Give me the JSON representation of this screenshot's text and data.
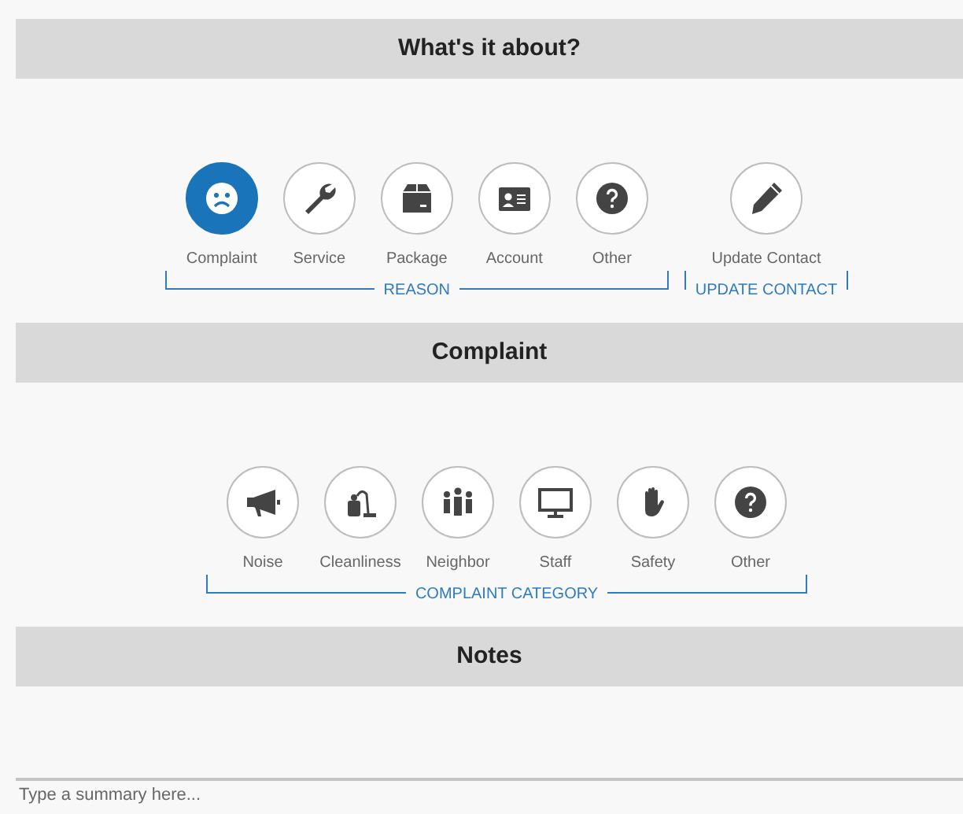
{
  "sections": [
    {
      "title": "What's it about?",
      "groups": [
        {
          "label": "REASON",
          "items": [
            {
              "kind": "sad-face",
              "label": "Complaint",
              "selected": true
            },
            {
              "kind": "wrench",
              "label": "Service",
              "selected": false
            },
            {
              "kind": "box",
              "label": "Package",
              "selected": false
            },
            {
              "kind": "id-card",
              "label": "Account",
              "selected": false
            },
            {
              "kind": "question",
              "label": "Other",
              "selected": false
            }
          ]
        },
        {
          "label": "UPDATE CONTACT",
          "items": [
            {
              "kind": "pencil",
              "label": "Update Contact",
              "selected": false
            }
          ]
        }
      ]
    },
    {
      "title": "Complaint",
      "groups": [
        {
          "label": "COMPLAINT CATEGORY",
          "items": [
            {
              "kind": "megaphone",
              "label": "Noise",
              "selected": false
            },
            {
              "kind": "vacuum",
              "label": "Cleanliness",
              "selected": false
            },
            {
              "kind": "people",
              "label": "Neighbor",
              "selected": false
            },
            {
              "kind": "monitor",
              "label": "Staff",
              "selected": false
            },
            {
              "kind": "hand",
              "label": "Safety",
              "selected": false
            },
            {
              "kind": "question",
              "label": "Other",
              "selected": false
            }
          ]
        }
      ]
    }
  ],
  "notes": {
    "title": "Notes",
    "placeholder": "Type a summary here..."
  }
}
